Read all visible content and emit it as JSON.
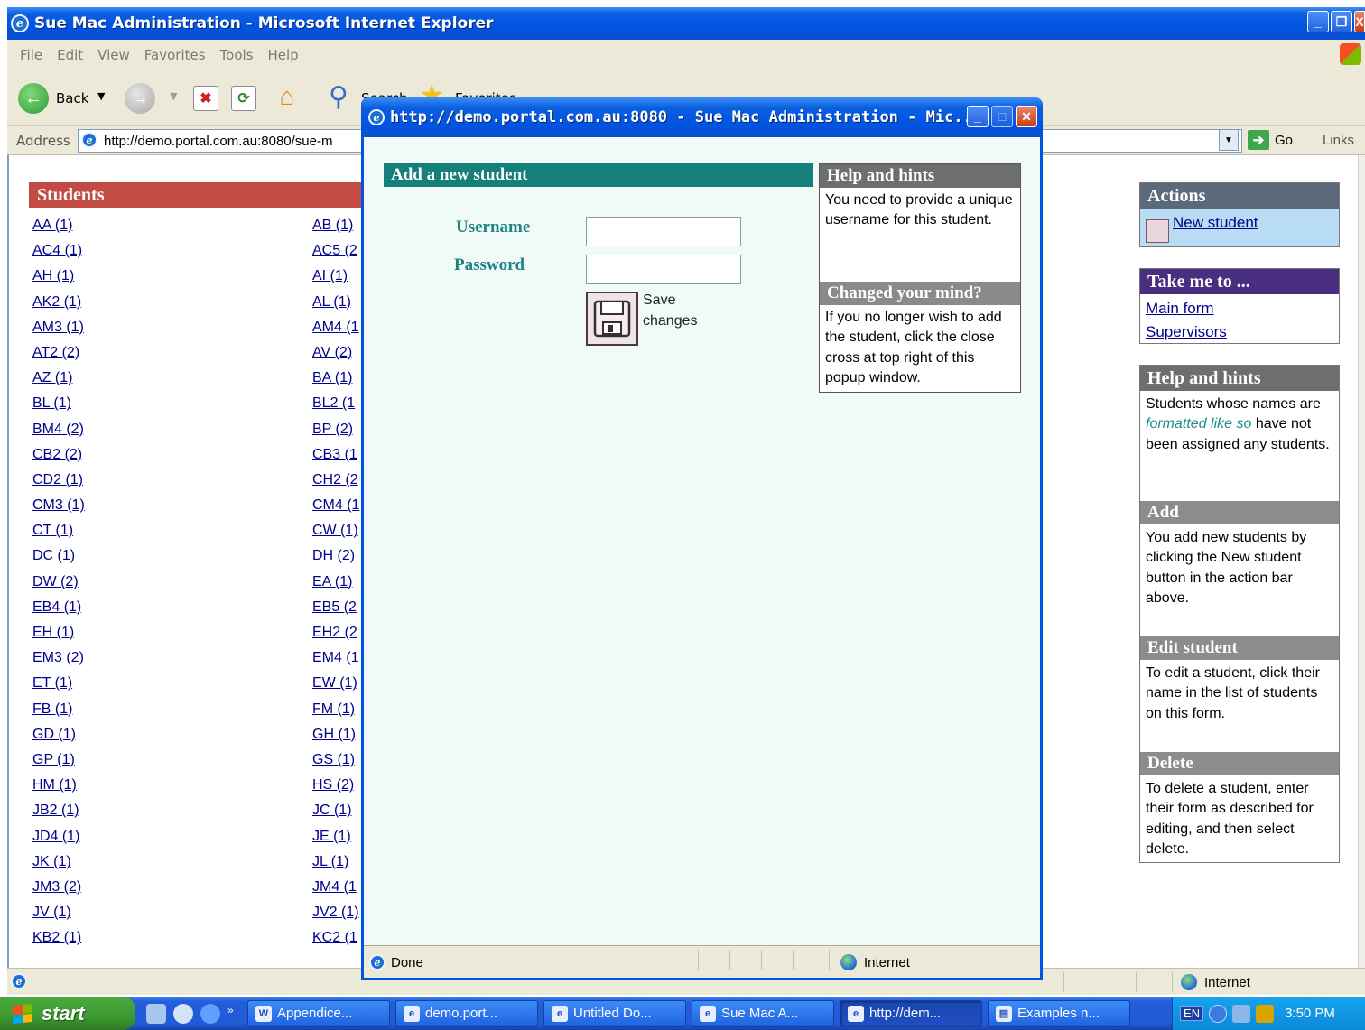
{
  "main_window": {
    "title": "Sue Mac Administration - Microsoft Internet Explorer",
    "menu": [
      "File",
      "Edit",
      "View",
      "Favorites",
      "Tools",
      "Help"
    ],
    "toolbar": {
      "back": "Back",
      "search": "Search",
      "favorites": "Favorites"
    },
    "address_label": "Address",
    "address_value": "http://demo.portal.com.au:8080/sue-m",
    "go_label": "Go",
    "links_label": "Links",
    "status_zone": "Internet"
  },
  "students": {
    "title": "Students",
    "col1": [
      "AA (1)",
      "AC4 (1)",
      "AH (1)",
      "AK2 (1)",
      "AM3 (1)",
      "AT2 (2)",
      "AZ (1)",
      "BL (1)",
      "BM4 (2)",
      "CB2 (2)",
      "CD2 (1)",
      "CM3 (1)",
      "CT (1)",
      "DC (1)",
      "DW (2)",
      "EB4 (1)",
      "EH (1)",
      "EM3 (2)",
      "ET (1)",
      "FB (1)",
      "GD (1)",
      "GP (1)",
      "HM (1)",
      "JB2 (1)",
      "JD4 (1)",
      "JK (1)",
      "JM3 (2)",
      "JV (1)",
      "KB2 (1)"
    ],
    "col2": [
      "AB (1)",
      "AC5 (2",
      "AI (1)",
      "AL (1)",
      "AM4 (1",
      "AV (2)",
      "BA (1)",
      "BL2 (1",
      "BP (2)",
      "CB3 (1",
      "CH2 (2",
      "CM4 (1",
      "CW (1)",
      "DH (2)",
      "EA (1)",
      "EB5 (2",
      "EH2 (2",
      "EM4 (1",
      "EW (1)",
      "FM (1)",
      "GH (1)",
      "GS (1)",
      "HS (2)",
      "JC (1)",
      "JE (1)",
      "JL (1)",
      "JM4 (1",
      "JV2 (1)",
      "KC2 (1"
    ]
  },
  "right_panels": {
    "actions": {
      "title": "Actions",
      "new_student": "New student"
    },
    "take_me_to": {
      "title": "Take me to ...",
      "links": [
        "Main form",
        "Supervisors"
      ]
    },
    "help": {
      "title": "Help and hints",
      "intro_1": "Students whose names are",
      "intro_em": "formatted like so",
      "intro_2": "have not been assigned any students.",
      "add_title": "Add",
      "add_text": "You add new students by clicking the New student button in the action bar above.",
      "edit_title": "Edit student",
      "edit_text": "To edit a student, click their name in the list of students on this form.",
      "delete_title": "Delete",
      "delete_text": "To delete a student, enter their form as described for editing, and then select delete."
    }
  },
  "popup": {
    "title": "http://demo.portal.com.au:8080 - Sue Mac Administration - Mic...",
    "header": "Add a new student",
    "username_label": "Username",
    "password_label": "Password",
    "username_value": "",
    "password_value": "",
    "save_label": "Save changes",
    "help_title": "Help and hints",
    "help_text": "You need to provide a unique username for this student.",
    "changed_title": "Changed your mind?",
    "changed_text": "If you no longer wish to add the student, click the close cross at top right of this popup window.",
    "status_done": "Done",
    "status_zone": "Internet"
  },
  "taskbar": {
    "start": "start",
    "tasks": [
      "Appendice...",
      "demo.port...",
      "Untitled Do...",
      "Sue Mac A...",
      "http://dem...",
      "Examples n..."
    ],
    "lang": "EN",
    "clock": "3:50 PM"
  },
  "colors": {
    "students_header": "#c24b43",
    "add_header": "#148079",
    "label_teal": "#1e8383",
    "take_me_to_header": "#4a2f80",
    "actions_panel": "#b7dcf3",
    "actions_header": "#5a6a7a"
  }
}
